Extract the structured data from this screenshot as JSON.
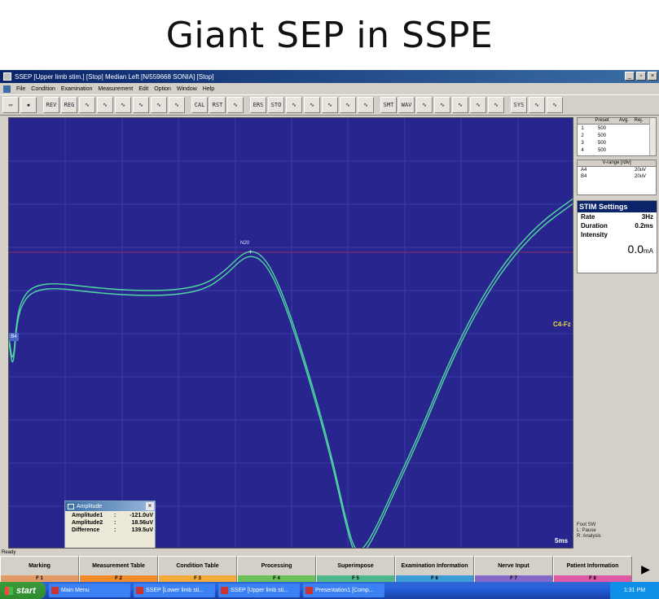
{
  "slide": {
    "title": "Giant SEP in SSPE"
  },
  "window": {
    "title": "SSEP  [Upper limb stim.]  [Stop]  Median  Left [N/559668  SONIA]  [Stop]",
    "buttons": [
      "_",
      "▫",
      "×"
    ]
  },
  "menu": [
    "File",
    "Condition",
    "Examination",
    "Measurement",
    "Edit",
    "Option",
    "Window",
    "Help"
  ],
  "toolbar": {
    "buttons": [
      "open",
      "save",
      "REV",
      "REG",
      "tool5",
      "tool6",
      "tool7",
      "tool8",
      "tool9",
      "tool10",
      "CAL",
      "RESET",
      "tool13",
      "ERASE",
      "STORE",
      "wave1",
      "wave2",
      "wave3",
      "wave4",
      "wave5",
      "SMOOTH",
      "WAVE",
      "view1",
      "view2",
      "grid1",
      "grid2",
      "grid3",
      "SYSTEM",
      "tool29",
      "tool30"
    ]
  },
  "plot": {
    "lead_label": "C4-Fz",
    "time_label": "5ms",
    "peak_label": "N20",
    "left_marker": "B4",
    "colors": {
      "background": "#29258f",
      "trace": "#4fd6a0",
      "grid": "#3b3aa6",
      "cursor": "#8a2a6a"
    }
  },
  "amplitude_box": {
    "title": "Amplitude",
    "close": "×",
    "rows": [
      {
        "key": "Amplitude1",
        "sep": ":",
        "value": "-121.0uV"
      },
      {
        "key": "Amplitude2",
        "sep": ":",
        "value": "18.56uV"
      },
      {
        "key": "Difference",
        "sep": ":",
        "value": "139.5uV"
      }
    ]
  },
  "preset_table": {
    "headers": [
      "",
      "Preset",
      "Avg.",
      "Rej."
    ],
    "rows": [
      [
        "1",
        "500",
        "",
        ""
      ],
      [
        "2",
        "500",
        "",
        ""
      ],
      [
        "3",
        "500",
        "",
        ""
      ],
      [
        "4",
        "500",
        "",
        ""
      ]
    ]
  },
  "vrange": {
    "title": "V-range [/div]",
    "rows": [
      {
        "ch": "A4",
        "val": "20uV"
      },
      {
        "ch": "B4",
        "val": "20uV"
      }
    ]
  },
  "stim": {
    "title": "STIM Settings",
    "rows": [
      {
        "k": "Rate",
        "v": "3Hz"
      },
      {
        "k": "Duration",
        "v": "0.2ms"
      },
      {
        "k": "Intensity",
        "v": ""
      }
    ],
    "intensity_value": "0.0",
    "intensity_unit": "mA"
  },
  "footswitch": {
    "title": "Foot SW",
    "l": "L: Pause",
    "r": "R: Analysis"
  },
  "status": "Ready",
  "fkeys": [
    {
      "label": "Marking",
      "key": "F 1",
      "color": "#e39a66"
    },
    {
      "label": "Measurement Table",
      "key": "F 2",
      "color": "#f08a2a"
    },
    {
      "label": "Condition Table",
      "key": "F 3",
      "color": "#f2ab3a"
    },
    {
      "label": "Processing",
      "key": "F 4",
      "color": "#6dc15a"
    },
    {
      "label": "Superimpose",
      "key": "F 5",
      "color": "#4fb88a"
    },
    {
      "label": "Examination Information",
      "key": "F 6",
      "color": "#3d9bd6"
    },
    {
      "label": "Nerve Input",
      "key": "F 7",
      "color": "#8469c9"
    },
    {
      "label": "Patient Information",
      "key": "F 8",
      "color": "#e05aa8"
    }
  ],
  "taskbar": {
    "start": "start",
    "tasks": [
      "Main Menu",
      "SSEP  [Lower limb sti...",
      "SSEP  [Upper limb sti...",
      "Presentation1 [Comp..."
    ],
    "clock": "1:31 PM"
  }
}
